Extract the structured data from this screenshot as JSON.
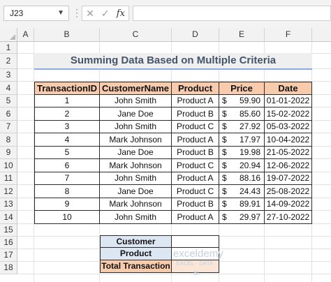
{
  "formula_bar": {
    "name_box": "J23",
    "fx_label": "fx",
    "formula_value": ""
  },
  "columns": [
    "A",
    "B",
    "C",
    "D",
    "E",
    "F"
  ],
  "rows": [
    "1",
    "2",
    "3",
    "4",
    "5",
    "6",
    "7",
    "8",
    "9",
    "10",
    "11",
    "12",
    "13",
    "14",
    "15",
    "16",
    "17",
    "18"
  ],
  "title": "Summing Data Based on Multiple Criteria",
  "table": {
    "headers": [
      "TransactionID",
      "CustomerName",
      "Product",
      "Price",
      "Date"
    ],
    "currency_symbol": "$",
    "rows": [
      {
        "id": "1",
        "customer": "John Smith",
        "product": "Product A",
        "price": "59.90",
        "date": "01-01-2022"
      },
      {
        "id": "2",
        "customer": "Jane Doe",
        "product": "Product B",
        "price": "85.60",
        "date": "15-02-2022"
      },
      {
        "id": "3",
        "customer": "John Smith",
        "product": "Product C",
        "price": "27.92",
        "date": "05-03-2022"
      },
      {
        "id": "4",
        "customer": "Mark Johnson",
        "product": "Product A",
        "price": "17.97",
        "date": "10-04-2022"
      },
      {
        "id": "5",
        "customer": "Jane Doe",
        "product": "Product B",
        "price": "19.98",
        "date": "21-05-2022"
      },
      {
        "id": "6",
        "customer": "Mark Johnson",
        "product": "Product C",
        "price": "20.94",
        "date": "12-06-2022"
      },
      {
        "id": "7",
        "customer": "John Smith",
        "product": "Product A",
        "price": "88.16",
        "date": "19-07-2022"
      },
      {
        "id": "8",
        "customer": "Jane Doe",
        "product": "Product C",
        "price": "24.43",
        "date": "25-08-2022"
      },
      {
        "id": "9",
        "customer": "Mark Johnson",
        "product": "Product B",
        "price": "89.91",
        "date": "14-09-2022"
      },
      {
        "id": "10",
        "customer": "John Smith",
        "product": "Product A",
        "price": "29.97",
        "date": "27-10-2022"
      }
    ]
  },
  "criteria": {
    "customer_label": "Customer",
    "product_label": "Product",
    "total_label": "Total Transaction",
    "customer_value": "",
    "product_value": "",
    "total_value": ""
  },
  "watermark": {
    "line1": "exceldemy",
    "line2": "EXCEL · DATA · BI"
  },
  "colors": {
    "header_fill": "#f8cbad",
    "criteria_fill": "#dde6f3",
    "title_color": "#44546a",
    "title_underline": "#8ea9db"
  }
}
